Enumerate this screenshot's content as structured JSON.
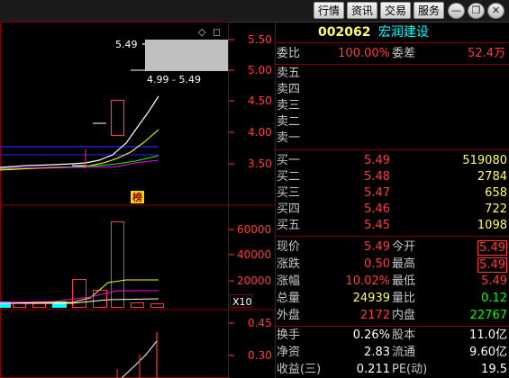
{
  "toolbar": {
    "buttons": [
      "行情",
      "资讯",
      "交易",
      "服务"
    ]
  },
  "window_controls": {
    "minimize": "—",
    "restore": "❐",
    "close": "✕"
  },
  "kline": {
    "badge": "榜",
    "range_label": "4.99 - 5.49",
    "price_label": "5.49",
    "y_ticks": [
      "5.50",
      "5.00",
      "4.50",
      "4.00",
      "3.50"
    ]
  },
  "volume": {
    "y_ticks": [
      "60000",
      "40000",
      "20000"
    ],
    "unit": "X10"
  },
  "indicator": {
    "y_ticks": [
      "0.45",
      "0.30"
    ]
  },
  "stock": {
    "code": "002062",
    "name": "宏润建设"
  },
  "order_ratio": {
    "label": "委比",
    "value": "100.00%",
    "diff_label": "委差",
    "diff_value": "52.4万"
  },
  "asks": [
    {
      "label": "卖五"
    },
    {
      "label": "卖四"
    },
    {
      "label": "卖三"
    },
    {
      "label": "卖二"
    },
    {
      "label": "卖一"
    }
  ],
  "bids": [
    {
      "label": "买一",
      "price": "5.49",
      "vol": "519080"
    },
    {
      "label": "买二",
      "price": "5.48",
      "vol": "2784"
    },
    {
      "label": "买三",
      "price": "5.47",
      "vol": "658"
    },
    {
      "label": "买四",
      "price": "5.46",
      "vol": "722"
    },
    {
      "label": "买五",
      "price": "5.45",
      "vol": "1098"
    }
  ],
  "quote": [
    {
      "l1": "现价",
      "v1": "5.49",
      "l2": "今开",
      "v2": "5.49"
    },
    {
      "l1": "涨跌",
      "v1": "0.50",
      "l2": "最高",
      "v2": "5.49"
    },
    {
      "l1": "涨幅",
      "v1": "10.02%",
      "l2": "最低",
      "v2": "5.49"
    },
    {
      "l1": "总量",
      "v1": "24939",
      "l2": "量比",
      "v2": "0.12"
    },
    {
      "l1": "外盘",
      "v1": "2172",
      "l2": "内盘",
      "v2": "22767"
    }
  ],
  "fundamentals": [
    {
      "l1": "换手",
      "v1": "0.26%",
      "l2": "股本",
      "v2": "11.0亿"
    },
    {
      "l1": "净资",
      "v1": "2.83",
      "l2": "流通",
      "v2": "9.60亿"
    },
    {
      "l1": "收益(三)",
      "v1": "0.211",
      "l2": "PE(动)",
      "v2": "19.5"
    }
  ],
  "colors": {
    "up": "#ff3b3b",
    "flat": "#ffff66",
    "down": "#00ff00",
    "label": "#c8c8c8",
    "accent_blue": "#00ffff",
    "grid": "#8b0000"
  }
}
